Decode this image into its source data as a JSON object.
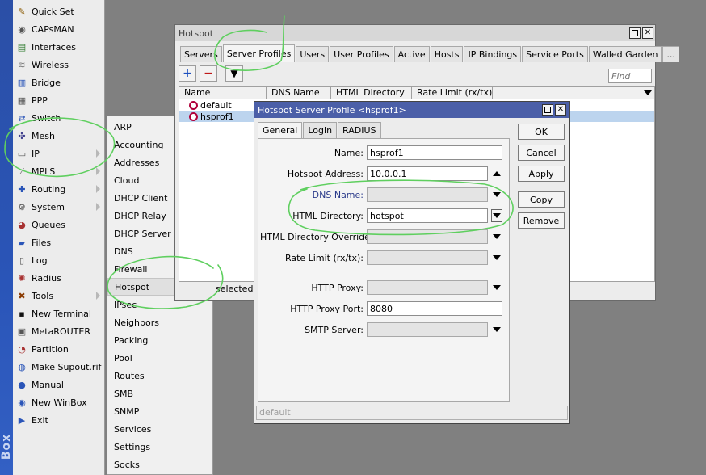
{
  "brand": {
    "text": "Box"
  },
  "main_menu": {
    "items": [
      {
        "label": "Quick Set",
        "icon": "quick-set-icon",
        "glyph": "✎",
        "color": "#8a5a00",
        "submenu": false
      },
      {
        "label": "CAPsMAN",
        "icon": "capsman-icon",
        "glyph": "◉",
        "color": "#555555",
        "submenu": false
      },
      {
        "label": "Interfaces",
        "icon": "interfaces-icon",
        "glyph": "▤",
        "color": "#2d7a2d",
        "submenu": false
      },
      {
        "label": "Wireless",
        "icon": "wireless-icon",
        "glyph": "≋",
        "color": "#777777",
        "submenu": false
      },
      {
        "label": "Bridge",
        "icon": "bridge-icon",
        "glyph": "▥",
        "color": "#2a55b8",
        "submenu": false
      },
      {
        "label": "PPP",
        "icon": "ppp-icon",
        "glyph": "▦",
        "color": "#555555",
        "submenu": false
      },
      {
        "label": "Switch",
        "icon": "switch-icon",
        "glyph": "⇄",
        "color": "#2a55b8",
        "submenu": false
      },
      {
        "label": "Mesh",
        "icon": "mesh-icon",
        "glyph": "✣",
        "color": "#3a3a8a",
        "submenu": false
      },
      {
        "label": "IP",
        "icon": "ip-icon",
        "glyph": "▭",
        "color": "#555555",
        "submenu": true
      },
      {
        "label": "MPLS",
        "icon": "mpls-icon",
        "glyph": "⁄",
        "color": "#777777",
        "submenu": true
      },
      {
        "label": "Routing",
        "icon": "routing-icon",
        "glyph": "✚",
        "color": "#2a55b8",
        "submenu": true
      },
      {
        "label": "System",
        "icon": "system-icon",
        "glyph": "⚙",
        "color": "#555555",
        "submenu": true
      },
      {
        "label": "Queues",
        "icon": "queues-icon",
        "glyph": "◕",
        "color": "#a83232",
        "submenu": false
      },
      {
        "label": "Files",
        "icon": "files-icon",
        "glyph": "▰",
        "color": "#2a55b8",
        "submenu": false
      },
      {
        "label": "Log",
        "icon": "log-icon",
        "glyph": "▯",
        "color": "#555555",
        "submenu": false
      },
      {
        "label": "Radius",
        "icon": "radius-icon",
        "glyph": "✺",
        "color": "#a83232",
        "submenu": false
      },
      {
        "label": "Tools",
        "icon": "tools-icon",
        "glyph": "✖",
        "color": "#8a3a00",
        "submenu": true
      },
      {
        "label": "New Terminal",
        "icon": "terminal-icon",
        "glyph": "▪",
        "color": "#111111",
        "submenu": false
      },
      {
        "label": "MetaROUTER",
        "icon": "metarouter-icon",
        "glyph": "▣",
        "color": "#555555",
        "submenu": false
      },
      {
        "label": "Partition",
        "icon": "partition-icon",
        "glyph": "◔",
        "color": "#a83232",
        "submenu": false
      },
      {
        "label": "Make Supout.rif",
        "icon": "supout-icon",
        "glyph": "◍",
        "color": "#2a55b8",
        "submenu": false
      },
      {
        "label": "Manual",
        "icon": "manual-icon",
        "glyph": "●",
        "color": "#2a55b8",
        "submenu": false
      },
      {
        "label": "New WinBox",
        "icon": "new-winbox-icon",
        "glyph": "◉",
        "color": "#2a55b8",
        "submenu": false
      },
      {
        "label": "Exit",
        "icon": "exit-icon",
        "glyph": "▶",
        "color": "#2a55b8",
        "submenu": false
      }
    ]
  },
  "ip_submenu": {
    "items": [
      "ARP",
      "Accounting",
      "Addresses",
      "Cloud",
      "DHCP Client",
      "DHCP Relay",
      "DHCP Server",
      "DNS",
      "Firewall",
      "Hotspot",
      "IPsec",
      "Neighbors",
      "Packing",
      "Pool",
      "Routes",
      "SMB",
      "SNMP",
      "Services",
      "Settings",
      "Socks"
    ],
    "highlighted": "Hotspot"
  },
  "hotspot_window": {
    "title": "Hotspot",
    "tabs": [
      "Servers",
      "Server Profiles",
      "Users",
      "User Profiles",
      "Active",
      "Hosts",
      "IP Bindings",
      "Service Ports",
      "Walled Garden",
      "..."
    ],
    "selected_tab": "Server Profiles",
    "find_placeholder": "Find",
    "columns": [
      "Name",
      "DNS Name",
      "HTML Directory",
      "Rate Limit (rx/tx)"
    ],
    "rows": [
      {
        "name": "default"
      },
      {
        "name": "hsprof1"
      }
    ],
    "status": "selected"
  },
  "profile_dialog": {
    "title": "Hotspot Server Profile <hsprof1>",
    "tabs": [
      "General",
      "Login",
      "RADIUS"
    ],
    "selected_tab": "General",
    "fields": {
      "name": {
        "label": "Name:",
        "value": "hsprof1"
      },
      "hotspot_address": {
        "label": "Hotspot Address:",
        "value": "10.0.0.1"
      },
      "dns_name": {
        "label": "DNS Name:",
        "value": ""
      },
      "html_directory": {
        "label": "HTML Directory:",
        "value": "hotspot"
      },
      "html_directory_override": {
        "label": "HTML Directory Override:",
        "value": ""
      },
      "rate_limit": {
        "label": "Rate Limit (rx/tx):",
        "value": ""
      },
      "http_proxy": {
        "label": "HTTP Proxy:",
        "value": ""
      },
      "http_proxy_port": {
        "label": "HTTP Proxy Port:",
        "value": "8080"
      },
      "smtp_server": {
        "label": "SMTP Server:",
        "value": ""
      }
    },
    "buttons": {
      "ok": "OK",
      "cancel": "Cancel",
      "apply": "Apply",
      "copy": "Copy",
      "remove": "Remove"
    },
    "status": "default"
  },
  "colors": {
    "dialog_titlebar": "#4b5fa8",
    "annotation_green": "#5fcf5f",
    "selected_row": "#bcd4ee"
  }
}
